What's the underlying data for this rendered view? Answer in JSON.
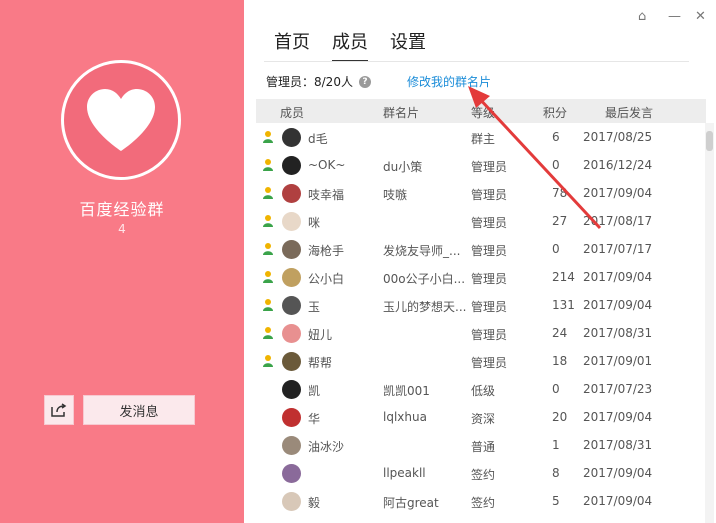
{
  "group": {
    "name": "百度经验群",
    "id": "4"
  },
  "actions": {
    "send_message": "发消息"
  },
  "tabs": [
    {
      "label": "首页",
      "active": false
    },
    {
      "label": "成员",
      "active": true
    },
    {
      "label": "设置",
      "active": false
    }
  ],
  "admin_count": "管理员：8/20人",
  "edit_card": "修改我的群名片",
  "columns": {
    "member": "成员",
    "card": "群名片",
    "level": "等级",
    "points": "积分",
    "last_post": "最后发言"
  },
  "members": [
    {
      "name": "d毛",
      "card": "",
      "level": "群主",
      "points": "6",
      "last": "2017/08/25",
      "admin": true,
      "avatar": "#333333"
    },
    {
      "name": "~OK~",
      "card": "du小策",
      "level": "管理员",
      "points": "0",
      "last": "2016/12/24",
      "admin": true,
      "avatar": "#222222"
    },
    {
      "name": "吱幸福",
      "card": "吱嗾",
      "level": "管理员",
      "points": "78",
      "last": "2017/09/04",
      "admin": true,
      "avatar": "#b04040"
    },
    {
      "name": "咪",
      "card": "",
      "level": "管理员",
      "points": "27",
      "last": "2017/08/17",
      "admin": true,
      "avatar": "#e8d8c8"
    },
    {
      "name": "海枪手",
      "card": "发烧友导师_...",
      "level": "管理员",
      "points": "0",
      "last": "2017/07/17",
      "admin": true,
      "avatar": "#7a6a5a"
    },
    {
      "name": "公小白",
      "card": "00o公子小白...",
      "level": "管理员",
      "points": "214",
      "last": "2017/09/04",
      "admin": true,
      "avatar": "#c0a060"
    },
    {
      "name": "玉",
      "card": "玉儿的梦想天...",
      "level": "管理员",
      "points": "131",
      "last": "2017/09/04",
      "admin": true,
      "avatar": "#555555"
    },
    {
      "name": "妞儿",
      "card": "",
      "level": "管理员",
      "points": "24",
      "last": "2017/08/31",
      "admin": true,
      "avatar": "#e89090"
    },
    {
      "name": "帮帮",
      "card": "",
      "level": "管理员",
      "points": "18",
      "last": "2017/09/01",
      "admin": true,
      "avatar": "#6b5a3a"
    },
    {
      "name": "凯",
      "card": "凯凯001",
      "level": "低级",
      "points": "0",
      "last": "2017/07/23",
      "admin": false,
      "avatar": "#222222"
    },
    {
      "name": "华",
      "card": "lqlxhua",
      "level": "资深",
      "points": "20",
      "last": "2017/09/04",
      "admin": false,
      "avatar": "#c03030"
    },
    {
      "name": "油冰沙",
      "card": "",
      "level": "普通",
      "points": "1",
      "last": "2017/08/31",
      "admin": false,
      "avatar": "#9a8a7a"
    },
    {
      "name": "",
      "card": "llpeakll",
      "level": "签约",
      "points": "8",
      "last": "2017/09/04",
      "admin": false,
      "avatar": "#8a6a9a"
    },
    {
      "name": "毅",
      "card": "阿古great",
      "level": "签约",
      "points": "5",
      "last": "2017/09/04",
      "admin": false,
      "avatar": "#d8c8b8"
    }
  ]
}
